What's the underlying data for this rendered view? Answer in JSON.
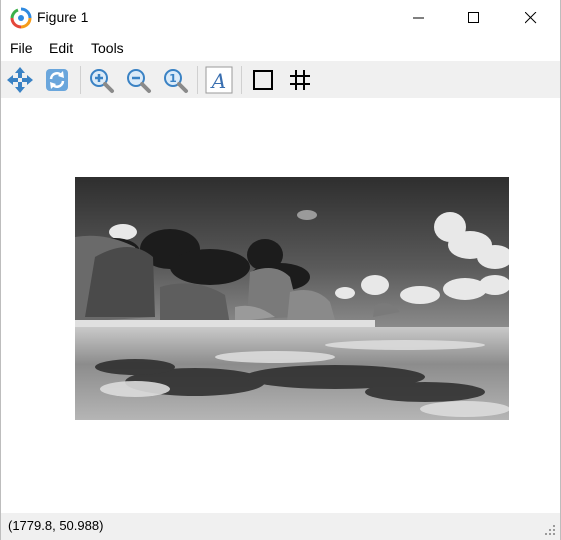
{
  "window": {
    "title": "Figure 1"
  },
  "menu": {
    "file": "File",
    "edit": "Edit",
    "tools": "Tools"
  },
  "toolbar": {
    "icons": [
      "pan-icon",
      "reset-view-icon",
      "zoom-in-icon",
      "zoom-out-icon",
      "zoom-100-icon",
      "text-icon",
      "rectangle-icon",
      "grid-icon"
    ],
    "text_tool_glyph": "A"
  },
  "status": {
    "coordinates": "(1779.8, 50.988)"
  },
  "colors": {
    "toolbar_bg": "#f0f0f0",
    "icon_blue": "#3a82c4",
    "status_bg": "#f0f0f0"
  }
}
